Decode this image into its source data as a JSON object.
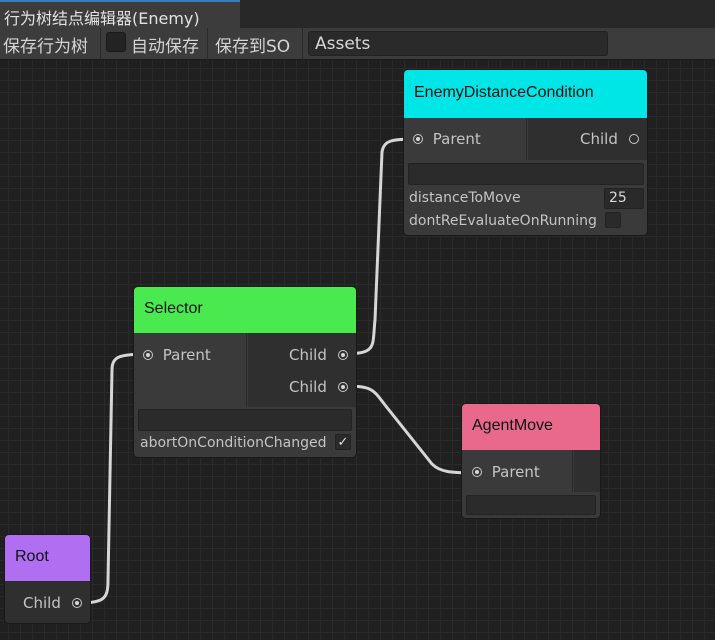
{
  "window": {
    "tab_title": "行为树结点编辑器(Enemy)"
  },
  "toolbar": {
    "save_tree_label": "保存行为树",
    "auto_save_label": "自动保存",
    "auto_save_checked": false,
    "save_to_so_label": "保存到SO",
    "path_value": "Assets"
  },
  "nodes": {
    "enemy_distance_condition": {
      "title": "EnemyDistanceCondition",
      "color": "#00e5e5",
      "parent_label": "Parent",
      "child_label": "Child",
      "props": {
        "distance_label": "distanceToMove",
        "distance_value": "25",
        "dont_reevaluate_label": "dontReEvaluateOnRunning",
        "dont_reevaluate_checked": false
      }
    },
    "selector": {
      "title": "Selector",
      "color": "#4ae94f",
      "parent_label": "Parent",
      "child1_label": "Child",
      "child2_label": "Child",
      "props": {
        "abort_label": "abortOnConditionChanged",
        "abort_checked": "✓"
      }
    },
    "agent_move": {
      "title": "AgentMove",
      "color": "#e8698c",
      "parent_label": "Parent"
    },
    "root": {
      "title": "Root",
      "color": "#b06ff0",
      "child_label": "Child"
    }
  },
  "colors": {
    "edge": "#d6d6d6",
    "background": "#202020",
    "node_body": "#3a3a3a"
  }
}
